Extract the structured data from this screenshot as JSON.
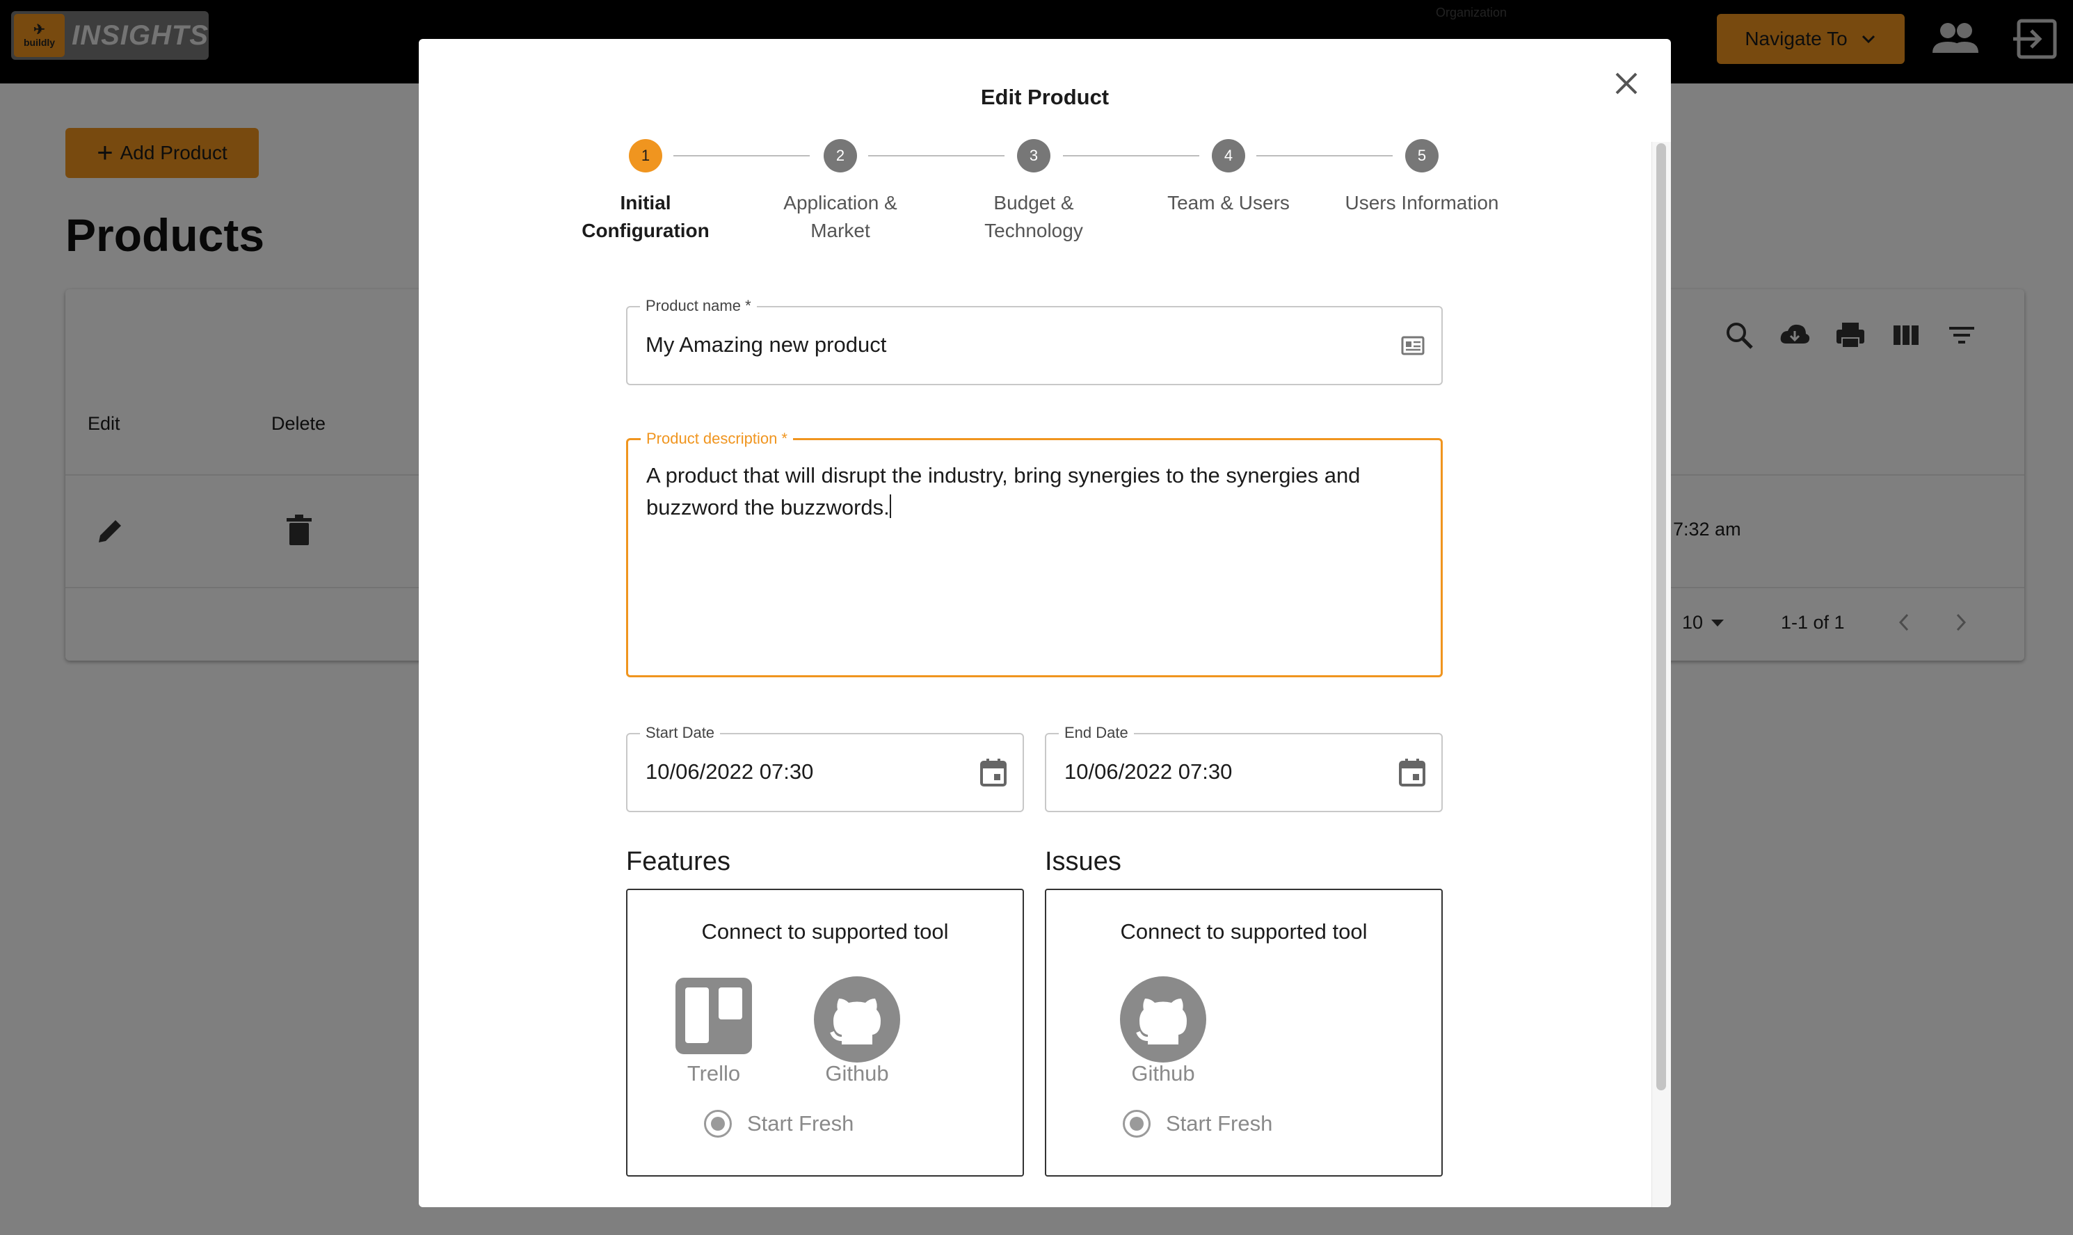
{
  "app": {
    "logo_mark": "buildly",
    "logo_text": "INSIGHTS",
    "header_small_text": "Organization",
    "navigate_label": "Navigate To",
    "colors": {
      "accent": "#f0951f",
      "appbar": "#000000"
    }
  },
  "page": {
    "add_button_label": "Add Product",
    "title": "Products",
    "columns": [
      "Edit",
      "Delete"
    ],
    "row": {
      "date_fragment": ", 7:32 am"
    },
    "pagination": {
      "rows_per_page": "10",
      "range": "1-1 of 1"
    },
    "toolbar_icons": [
      "search-icon",
      "download-icon",
      "print-icon",
      "view-columns-icon",
      "filter-icon"
    ]
  },
  "modal": {
    "title": "Edit Product",
    "steps": [
      {
        "number": "1",
        "line1": "Initial",
        "line2": "Configuration",
        "active": true
      },
      {
        "number": "2",
        "line1": "Application &",
        "line2": "Market",
        "active": false
      },
      {
        "number": "3",
        "line1": "Budget &",
        "line2": "Technology",
        "active": false
      },
      {
        "number": "4",
        "line1": "Team & Users",
        "line2": "",
        "active": false
      },
      {
        "number": "5",
        "line1": "Users Information",
        "line2": "",
        "active": false
      }
    ],
    "product_name": {
      "label": "Product name *",
      "value": "My Amazing new product"
    },
    "product_description": {
      "label": "Product description *",
      "value": "A product that will disrupt the industry, bring synergies to the synergies and buzzword the buzzwords."
    },
    "start_date": {
      "label": "Start Date",
      "value": "10/06/2022 07:30"
    },
    "end_date": {
      "label": "End Date",
      "value": "10/06/2022 07:30"
    },
    "features": {
      "title": "Features",
      "box_title": "Connect to supported tool",
      "tools": [
        "Trello",
        "Github"
      ],
      "option": "Start Fresh"
    },
    "issues": {
      "title": "Issues",
      "box_title": "Connect to supported tool",
      "tools": [
        "Github"
      ],
      "option": "Start Fresh"
    }
  }
}
